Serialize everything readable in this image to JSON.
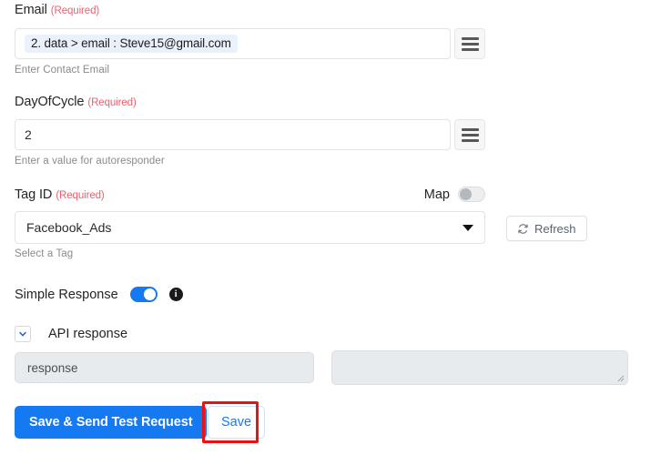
{
  "colors": {
    "accent": "#1579f2",
    "required": "#ef5e6e",
    "helper": "#8a8a8a",
    "chip_bg": "#eaf1fb",
    "highlight": "#ee1111",
    "disabled_bg": "#e8ebee"
  },
  "fields": {
    "email": {
      "label": "Email",
      "required_text": "(Required)",
      "value": "2. data > email : Steve15@gmail.com",
      "helper": "Enter Contact Email",
      "menu_icon": "hamburger-icon"
    },
    "day_of_cycle": {
      "label": "DayOfCycle",
      "required_text": "(Required)",
      "value": "2",
      "placeholder": "",
      "helper": "Enter a value for autoresponder",
      "menu_icon": "hamburger-icon"
    },
    "tag_id": {
      "label": "Tag ID",
      "required_text": "(Required)",
      "map_label": "Map",
      "map_toggle_state": "off",
      "selected_option": "Facebook_Ads",
      "helper": "Select a Tag",
      "refresh_label": "Refresh",
      "refresh_icon": "refresh-icon",
      "caret_icon": "chevron-down-icon"
    }
  },
  "simple_response": {
    "label": "Simple Response",
    "toggle_state": "on",
    "info_icon": "info-icon",
    "info_glyph": "i"
  },
  "api_response": {
    "section_label": "API response",
    "collapse_icon": "chevron-down-icon",
    "key_value": "response",
    "value_value": "",
    "resize_icon": "resize-grip-icon"
  },
  "actions": {
    "save_and_send_label": "Save & Send Test Request",
    "save_label": "Save",
    "save_highlighted": true
  }
}
